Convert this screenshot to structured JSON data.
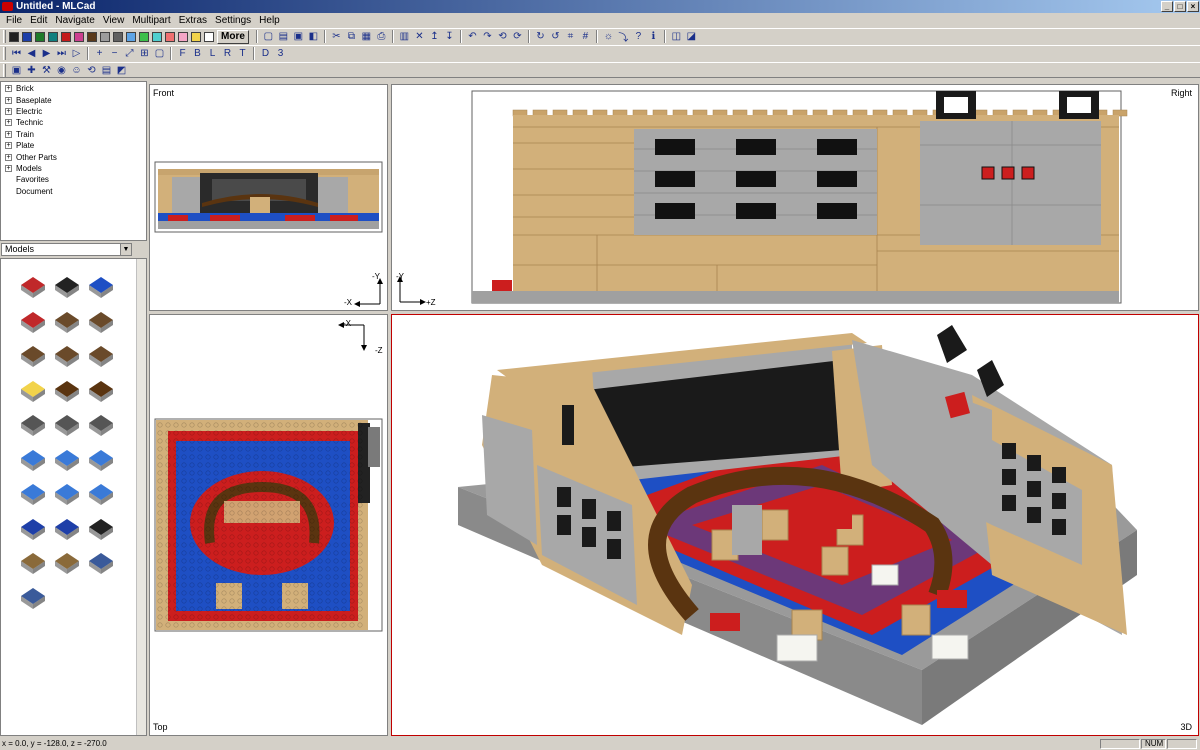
{
  "window": {
    "title": "Untitled - MLCad"
  },
  "menu": [
    {
      "label": "File"
    },
    {
      "label": "Edit"
    },
    {
      "label": "Navigate"
    },
    {
      "label": "View"
    },
    {
      "label": "Multipart"
    },
    {
      "label": "Extras"
    },
    {
      "label": "Settings"
    },
    {
      "label": "Help"
    }
  ],
  "toolbar": {
    "more_label": "More",
    "colors": [
      "#202020",
      "#1e3fa8",
      "#1f7a2a",
      "#107f7f",
      "#c41b1b",
      "#cc3f8f",
      "#5a3a1a",
      "#9c9c9c",
      "#606060",
      "#5da4e6",
      "#3cbf4a",
      "#4fcfcf",
      "#ef7070",
      "#f4a6c6",
      "#f2d34b",
      "#ffffff"
    ],
    "row1": [
      "new-icon",
      "open-icon",
      "save-icon",
      "save-as-icon",
      "cut-icon",
      "copy-icon",
      "paste-icon",
      "print-icon",
      "properties-icon",
      "delete-icon",
      "move-up-icon",
      "move-down-icon",
      "rotate-left-icon",
      "rotate-right-icon",
      "rotate-up-icon",
      "rotate-down-icon",
      "rotate-cw-icon",
      "rotate-ccw-icon",
      "snap-icon",
      "grid-icon",
      "light-icon",
      "bend-icon",
      "help-icon",
      "about-icon",
      "group-icon",
      "ungroup-icon"
    ],
    "row2": [
      "first-step-icon",
      "prev-step-icon",
      "next-step-icon",
      "last-step-icon",
      "play-icon",
      "zoom-in-icon",
      "zoom-out-icon",
      "zoom-fit-icon",
      "view-four-icon",
      "view-one-icon",
      "view-front-icon",
      "view-back-icon",
      "view-left-icon",
      "view-right-icon",
      "view-top-icon",
      "view-bottom-icon",
      "view-3d-icon"
    ],
    "row3": [
      "add-brick-icon",
      "build-icon",
      "camera-icon",
      "minifig-icon",
      "rotation-icon",
      "buffer-icon",
      "group-icon",
      "comment-icon"
    ]
  },
  "tree": {
    "items": [
      {
        "label": "Brick",
        "expand": "+"
      },
      {
        "label": "Baseplate",
        "expand": "+"
      },
      {
        "label": "Electric",
        "expand": "+"
      },
      {
        "label": "Technic",
        "expand": "+"
      },
      {
        "label": "Train",
        "expand": "+"
      },
      {
        "label": "Plate",
        "expand": "+"
      },
      {
        "label": "Other Parts",
        "expand": "+"
      },
      {
        "label": "Models",
        "expand": "+"
      },
      {
        "label": "Favorites",
        "expand": ""
      },
      {
        "label": "Document",
        "expand": ""
      }
    ]
  },
  "models_dropdown": {
    "selected": "Models"
  },
  "parts_preview": {
    "count": 28,
    "items": [
      "car",
      "black-brick",
      "blue-baseplate",
      "minifig-red",
      "computer-desk",
      "computer-desk",
      "computer-desk",
      "computer-desk",
      "computer-desk",
      "minifig-pirate",
      "pirate-ship",
      "pirate-ship",
      "ghost-ship",
      "ghost-ship",
      "ghost-ship",
      "blue-pool",
      "blue-pool",
      "blue-pool",
      "blue-pool",
      "blue-pool",
      "blue-pool",
      "minifig-blue",
      "minifig-blue",
      "minifig-black",
      "bridge-room",
      "bridge-room",
      "castle",
      "castle"
    ]
  },
  "views": {
    "front": {
      "label": "Front",
      "axis_up": "-Y",
      "axis_side": "-X"
    },
    "right": {
      "label": "Right",
      "axis_up": "-Y",
      "axis_side": "+Z"
    },
    "top": {
      "label": "Top",
      "axis_side": "-X",
      "axis_down": "-Z"
    },
    "view3d": {
      "label": "3D"
    }
  },
  "status": {
    "coords": "x = 0.0, y = -128.0, z = -270.0",
    "num": "NUM"
  },
  "colors": {
    "title_start": "#0a246a",
    "title_end": "#a6caf0",
    "active_view_border": "#c00000",
    "tan": "#d2b07a",
    "gray": "#a0a0a0",
    "red": "#cc1e1e",
    "blue": "#1e4fc4",
    "brown": "#5a3410"
  }
}
